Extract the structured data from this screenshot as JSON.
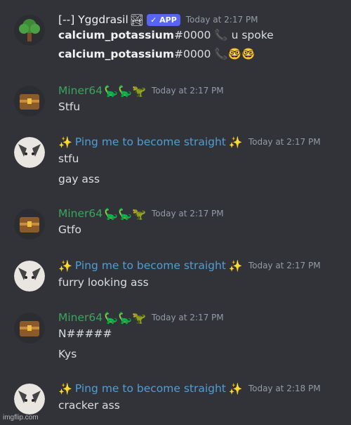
{
  "messages": [
    {
      "author": "[--] Yggdrasil",
      "author_color": "#f2f3f5",
      "author_emojis": "🏞",
      "badge": "✓ APP",
      "timestamp": "Today at 2:17 PM",
      "avatar": "tree-avatar",
      "lines": [
        {
          "bold": "calcium_potassium",
          "rest": "#0000",
          "emoji": "📞",
          "text": "u spoke"
        },
        {
          "bold": "calcium_potassium",
          "rest": "#0000",
          "emoji": "📞",
          "text": "🤓🤓"
        }
      ]
    },
    {
      "author": "Miner64",
      "author_color": "#3ba55d",
      "author_emojis": "🦕🦕🦖",
      "timestamp": "Today at 2:17 PM",
      "avatar": "chest-avatar",
      "lines": [
        "Stfu"
      ]
    },
    {
      "author": "Ping me to become straight",
      "author_color": "#4f9ed8",
      "prefix_emoji": "✨",
      "suffix_emoji": "✨",
      "timestamp": "Today at 2:17 PM",
      "avatar": "cat-avatar",
      "lines": [
        "stfu",
        "gay ass"
      ]
    },
    {
      "author": "Miner64",
      "author_color": "#3ba55d",
      "author_emojis": "🦕🦕🦖",
      "timestamp": "Today at 2:17 PM",
      "avatar": "chest-avatar",
      "lines": [
        "Gtfo"
      ]
    },
    {
      "author": "Ping me to become straight",
      "author_color": "#4f9ed8",
      "prefix_emoji": "✨",
      "suffix_emoji": "✨",
      "timestamp": "Today at 2:17 PM",
      "avatar": "cat-avatar",
      "lines": [
        "furry looking ass"
      ]
    },
    {
      "author": "Miner64",
      "author_color": "#3ba55d",
      "author_emojis": "🦕🦕🦖",
      "timestamp": "Today at 2:17 PM",
      "avatar": "chest-avatar",
      "lines": [
        "N#####",
        "Kys"
      ]
    },
    {
      "author": "Ping me to become straight",
      "author_color": "#4f9ed8",
      "prefix_emoji": "✨",
      "suffix_emoji": "✨",
      "timestamp": "Today at 2:18 PM",
      "avatar": "cat-avatar",
      "lines": [
        "cracker ass"
      ]
    }
  ],
  "watermark": "imgflip.com"
}
